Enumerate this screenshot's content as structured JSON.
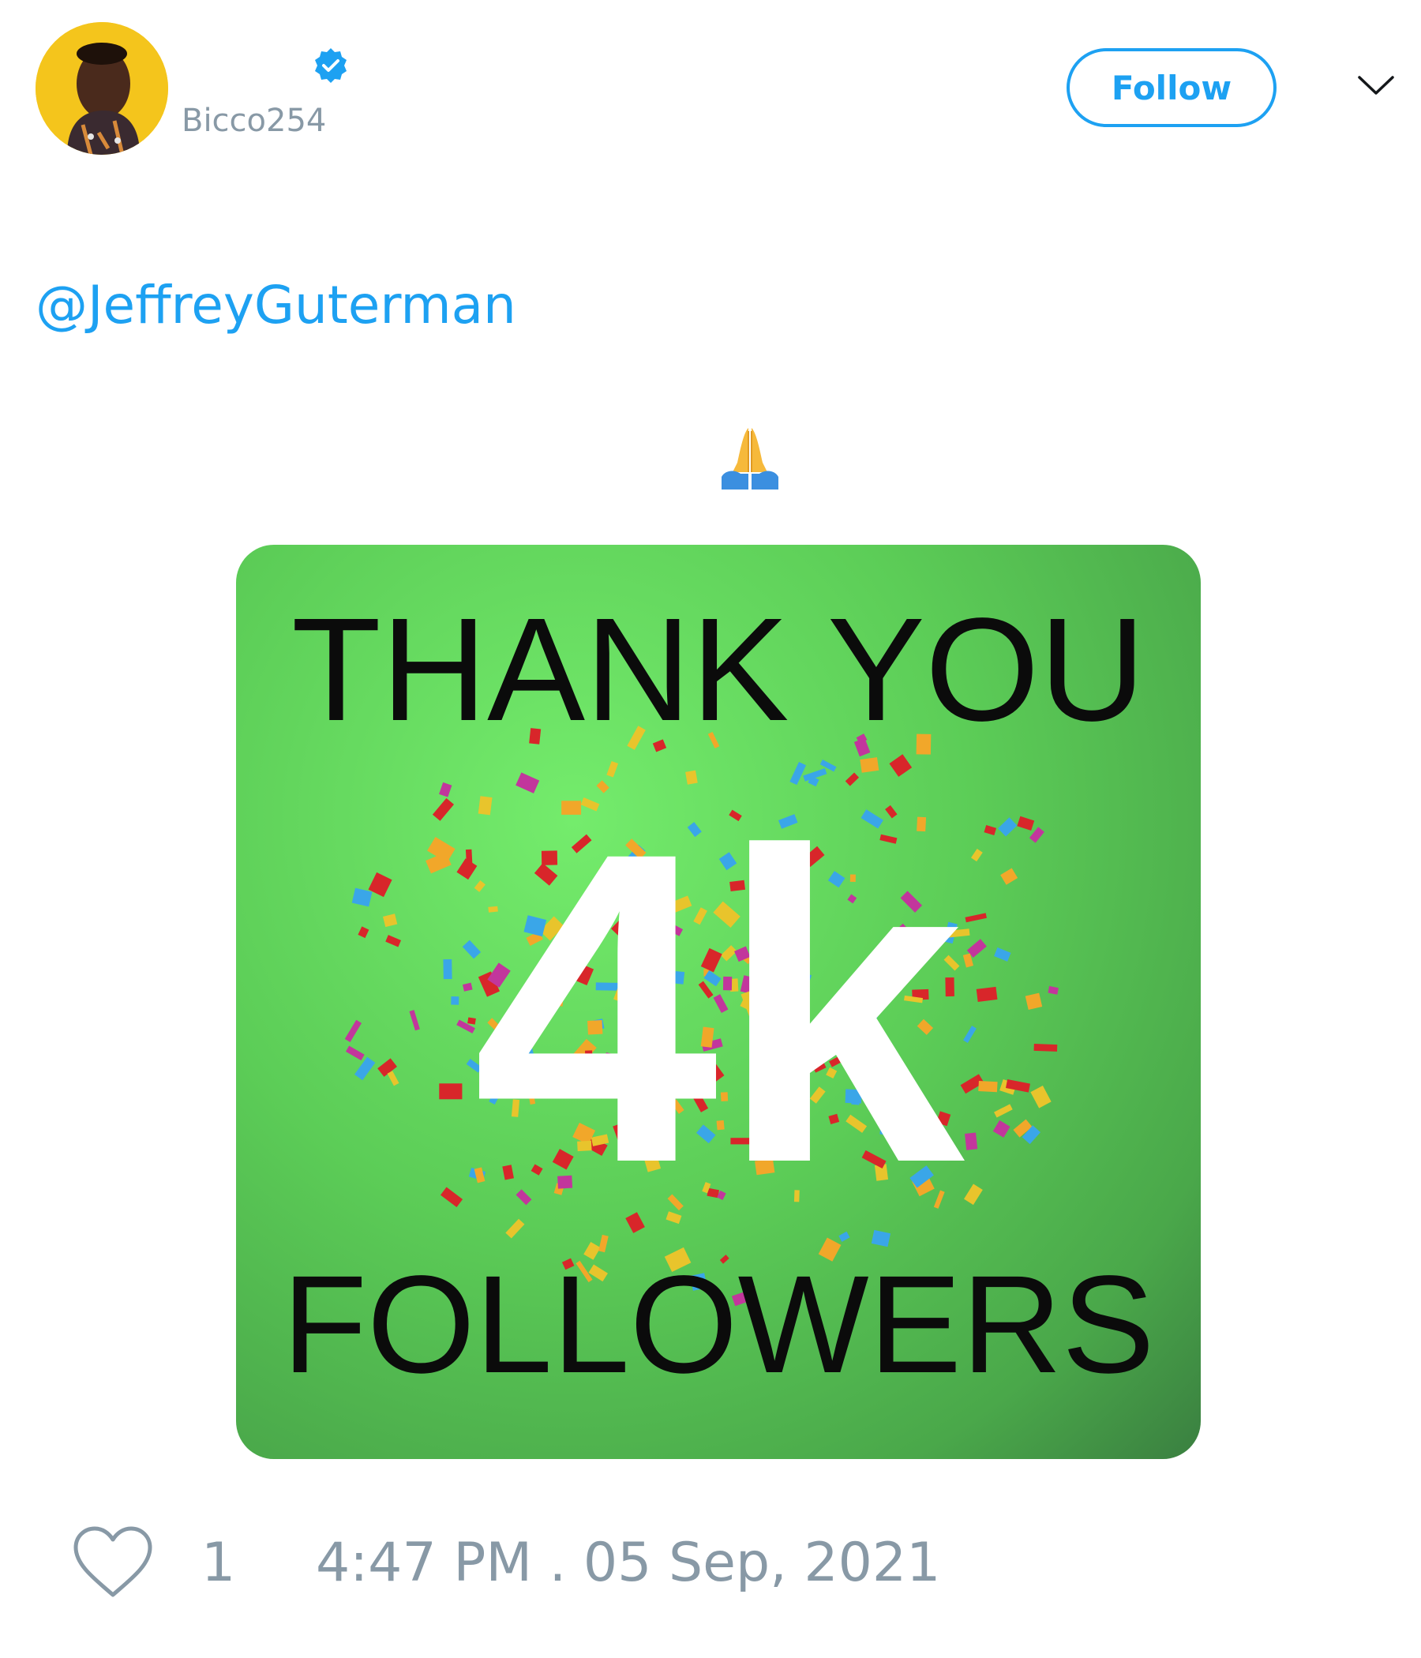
{
  "tweet": {
    "author": {
      "handle": "Bicco254",
      "verified": true,
      "avatar_icon": "profile-photo"
    },
    "follow_label": "Follow",
    "menu_icon": "chevron-down-icon",
    "mention": "@JeffreyGuterman",
    "emoji": "folded-hands",
    "media": {
      "line1": "THANK YOU",
      "number": "4k",
      "line2": "FOLLOWERS",
      "background_color": "#5ccd57"
    },
    "likes": "1",
    "timestamp": "4:47 PM . 05 Sep, 2021"
  },
  "colors": {
    "accent": "#1da1f2",
    "muted": "#8899a6"
  }
}
